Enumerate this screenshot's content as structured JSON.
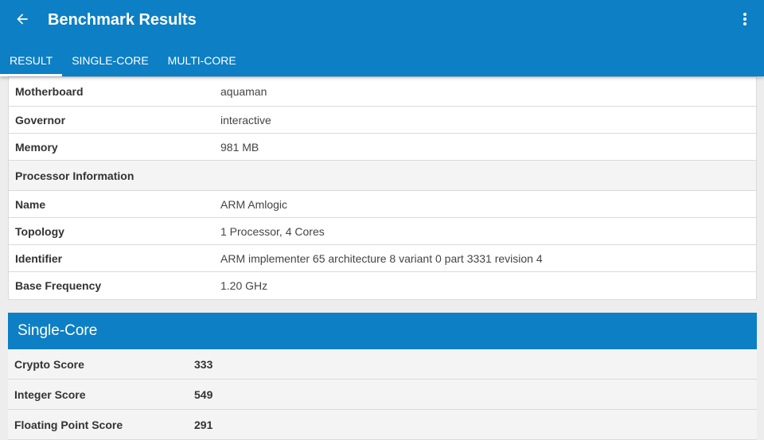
{
  "appbar": {
    "title": "Benchmark Results",
    "back_icon": "arrow-back-icon",
    "overflow_icon": "more-vert-icon",
    "color": "#0d7fc4"
  },
  "tabs": [
    {
      "label": "RESULT",
      "active": true
    },
    {
      "label": "SINGLE-CORE",
      "active": false
    },
    {
      "label": "MULTI-CORE",
      "active": false
    }
  ],
  "system_info": {
    "rows": [
      {
        "label": "Motherboard",
        "value": "aquaman"
      },
      {
        "label": "Governor",
        "value": "interactive"
      },
      {
        "label": "Memory",
        "value": "981 MB"
      }
    ]
  },
  "processor_info": {
    "heading": "Processor Information",
    "rows": [
      {
        "label": "Name",
        "value": "ARM Amlogic"
      },
      {
        "label": "Topology",
        "value": "1 Processor, 4 Cores"
      },
      {
        "label": "Identifier",
        "value": "ARM implementer 65 architecture 8 variant 0 part 3331 revision 4"
      },
      {
        "label": "Base Frequency",
        "value": "1.20 GHz"
      }
    ]
  },
  "single_core": {
    "heading": "Single-Core",
    "rows": [
      {
        "label": "Crypto Score",
        "value": "333"
      },
      {
        "label": "Integer Score",
        "value": "549"
      },
      {
        "label": "Floating Point Score",
        "value": "291"
      }
    ]
  }
}
